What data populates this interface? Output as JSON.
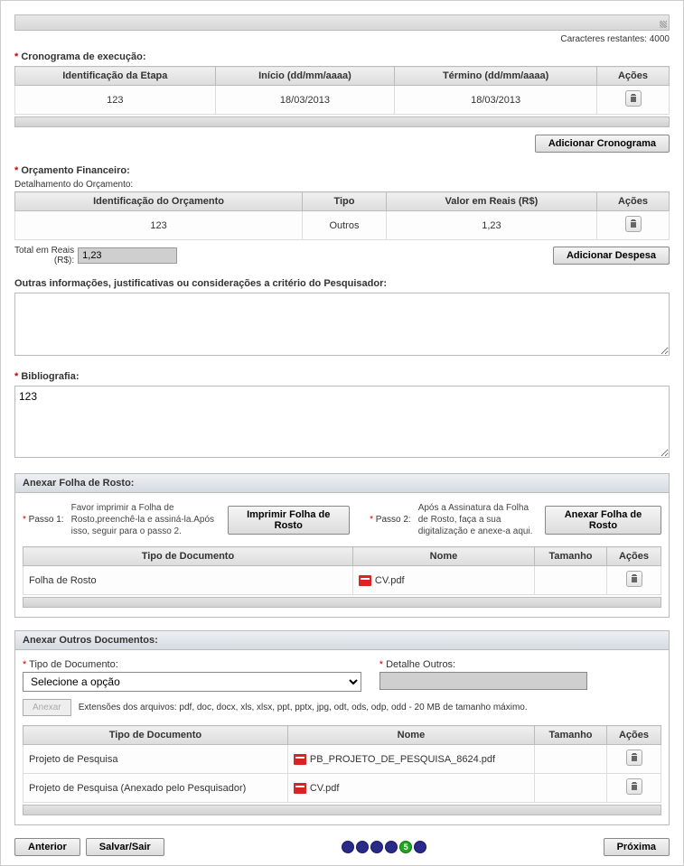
{
  "char_counter_label": "Caracteres restantes:",
  "char_counter_value": "4000",
  "cronograma": {
    "label": "Cronograma de execução:",
    "headers": [
      "Identificação da Etapa",
      "Início (dd/mm/aaaa)",
      "Término (dd/mm/aaaa)",
      "Ações"
    ],
    "rows": [
      {
        "etapa": "123",
        "inicio": "18/03/2013",
        "termino": "18/03/2013"
      }
    ],
    "add_btn": "Adicionar Cronograma"
  },
  "orcamento": {
    "label": "Orçamento Financeiro:",
    "sublabel": "Detalhamento do Orçamento:",
    "headers": [
      "Identificação do Orçamento",
      "Tipo",
      "Valor em Reais (R$)",
      "Ações"
    ],
    "rows": [
      {
        "ident": "123",
        "tipo": "Outros",
        "valor": "1,23"
      }
    ],
    "total_label": "Total em Reais\n(R$):",
    "total_value": "1,23",
    "add_btn": "Adicionar Despesa"
  },
  "outras": {
    "label": "Outras informações, justificativas ou considerações a critério do Pesquisador:",
    "value": ""
  },
  "biblio": {
    "label": "Bibliografia:",
    "value": "123"
  },
  "rosto": {
    "title": "Anexar Folha de Rosto:",
    "p1_label": "Passo 1:",
    "p1_text": "Favor imprimir a Folha de Rosto,preenchê-la e assiná-la.Após isso, seguir para o passo 2.",
    "p1_btn": "Imprimir Folha de Rosto",
    "p2_label": "Passo 2:",
    "p2_text": "Após a Assinatura da Folha de Rosto, faça a sua digitalização e anexe-a aqui.",
    "p2_btn": "Anexar Folha de Rosto",
    "headers": [
      "Tipo de Documento",
      "Nome",
      "Tamanho",
      "Ações"
    ],
    "rows": [
      {
        "tipo": "Folha de Rosto",
        "nome": "CV.pdf",
        "tam": ""
      }
    ]
  },
  "outros_docs": {
    "title": "Anexar Outros Documentos:",
    "tipo_label": "Tipo de Documento:",
    "tipo_selected": "Selecione a opção",
    "detalhe_label": "Detalhe Outros:",
    "detalhe_value": "",
    "anexar_btn": "Anexar",
    "ext_note": "Extensões dos arquivos: pdf, doc, docx, xls, xlsx, ppt, pptx, jpg, odt, ods, odp, odd - 20 MB de tamanho máximo.",
    "headers": [
      "Tipo de Documento",
      "Nome",
      "Tamanho",
      "Ações"
    ],
    "rows": [
      {
        "tipo": "Projeto de Pesquisa",
        "nome": "PB_PROJETO_DE_PESQUISA_8624.pdf",
        "tam": ""
      },
      {
        "tipo": "Projeto de Pesquisa (Anexado pelo Pesquisador)",
        "nome": "CV.pdf",
        "tam": ""
      }
    ]
  },
  "footer": {
    "anterior": "Anterior",
    "salvar": "Salvar/Sair",
    "proxima": "Próxima",
    "active_step": "5"
  }
}
